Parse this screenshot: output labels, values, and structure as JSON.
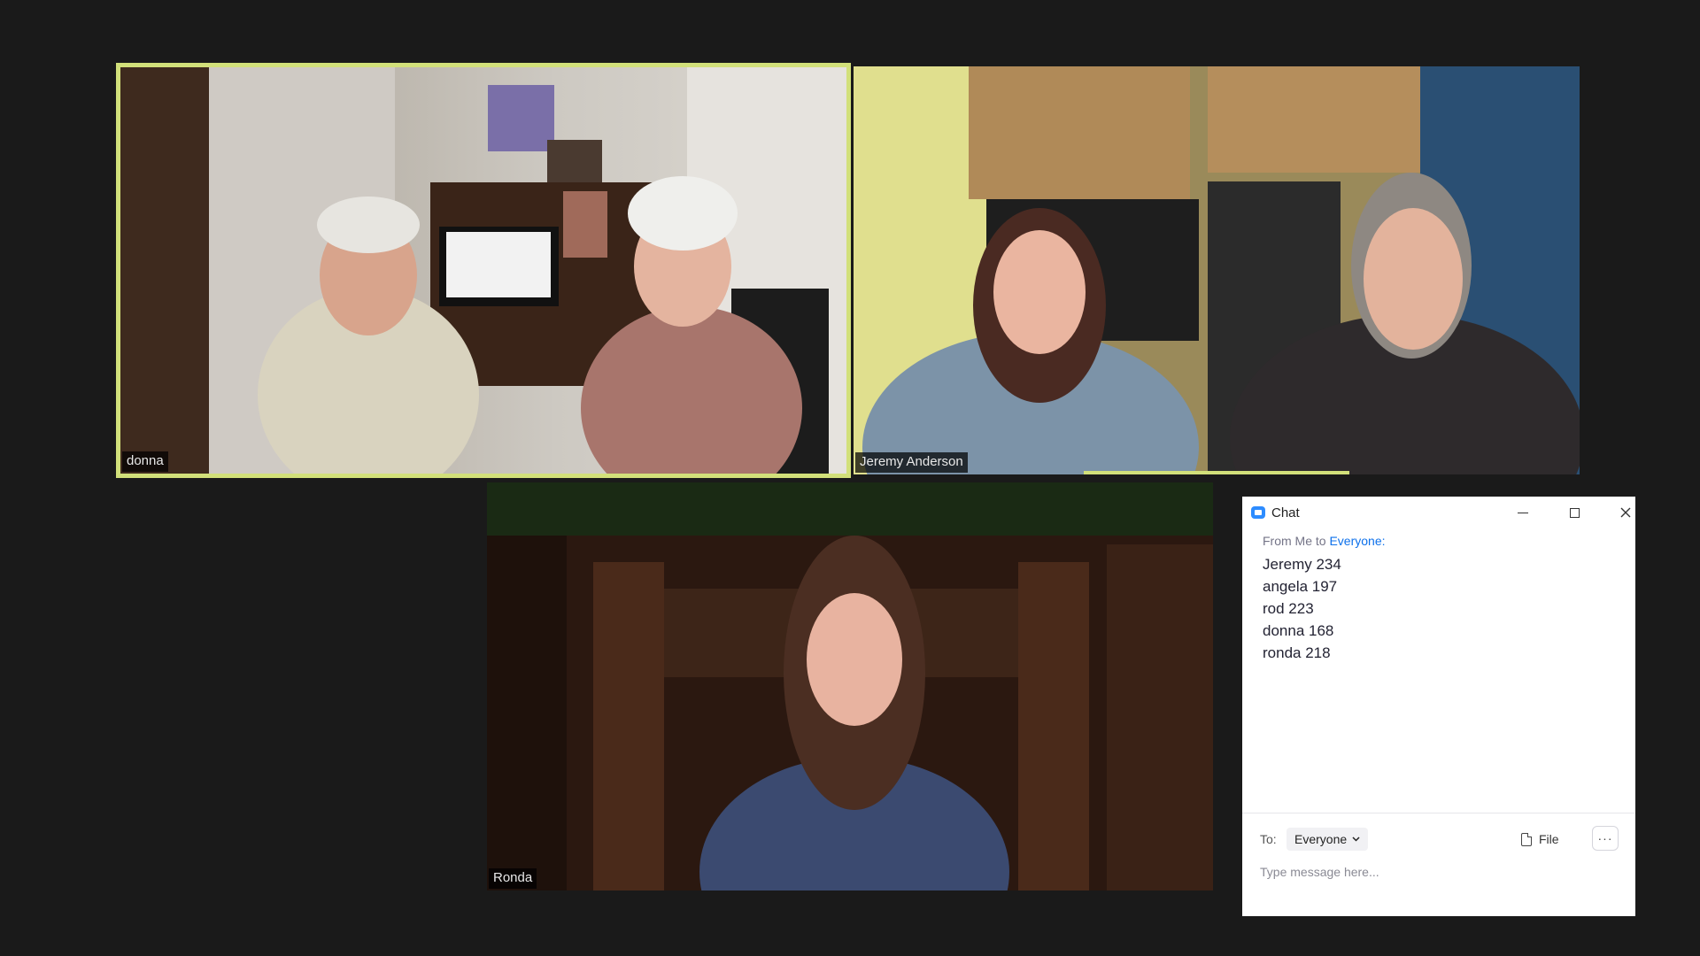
{
  "participants": [
    {
      "id": "donna",
      "name": "donna",
      "active_speaker": true
    },
    {
      "id": "jeremy",
      "name": "Jeremy Anderson",
      "active_speaker": false
    },
    {
      "id": "ronda",
      "name": "Ronda",
      "active_speaker": false
    }
  ],
  "chat": {
    "title": "Chat",
    "message": {
      "from_label": "From Me to ",
      "to_target": "Everyone:",
      "lines": [
        "Jeremy 234",
        "angela 197",
        "rod 223",
        "donna 168",
        "ronda 218"
      ]
    },
    "to_label": "To:",
    "recipient": "Everyone",
    "file_label": "File",
    "more_label": "···",
    "input_placeholder": "Type message here..."
  },
  "colors": {
    "background": "#1a1a1a",
    "active_speaker_border": "#d2e07a",
    "accent_blue": "#0e71eb",
    "zoom_logo": "#2d8cff"
  },
  "icons": [
    "zoom-chat-icon",
    "minimize-icon",
    "maximize-icon",
    "close-icon",
    "chevron-down-icon",
    "file-icon",
    "more-icon"
  ]
}
